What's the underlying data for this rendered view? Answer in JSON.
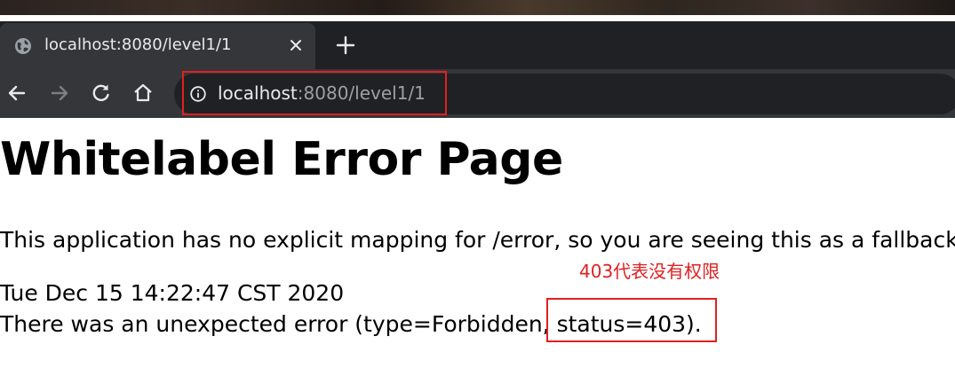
{
  "browser": {
    "tab_title": "localhost:8080/level1/1",
    "new_tab_symbol": "+",
    "close_symbol": "✕",
    "address": {
      "host": "localhost",
      "rest": ":8080/level1/1"
    },
    "icons": [
      "globe-icon",
      "close-icon",
      "plus-icon",
      "back-icon",
      "forward-icon",
      "reload-icon",
      "home-icon",
      "info-icon"
    ]
  },
  "page": {
    "title": "Whitelabel Error Page",
    "message": "This application has no explicit mapping for /error, so you are seeing this as a fallback.",
    "timestamp": "Tue Dec 15 14:22:47 CST 2020",
    "error_line": "There was an unexpected error (type=Forbidden, status=403)."
  },
  "annotation": {
    "note": "403代表没有权限",
    "color": "#e02020"
  }
}
